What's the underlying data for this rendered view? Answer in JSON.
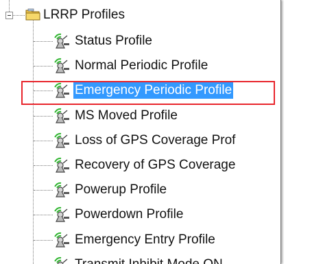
{
  "tree": {
    "root": {
      "label": "LRRP Profiles",
      "icon": "folder-icon",
      "expanded": true
    },
    "items": [
      {
        "label": "Status Profile",
        "icon": "gps-antenna-icon"
      },
      {
        "label": "Normal Periodic Profile",
        "icon": "gps-antenna-icon"
      },
      {
        "label": "Emergency Periodic Profile",
        "icon": "gps-antenna-icon",
        "selected": true
      },
      {
        "label": "MS Moved Profile",
        "icon": "gps-antenna-icon"
      },
      {
        "label": "Loss of GPS Coverage Prof",
        "icon": "gps-antenna-icon"
      },
      {
        "label": "Recovery of GPS Coverage",
        "icon": "gps-antenna-icon"
      },
      {
        "label": "Powerup Profile",
        "icon": "gps-antenna-icon"
      },
      {
        "label": "Powerdown Profile",
        "icon": "gps-antenna-icon"
      },
      {
        "label": "Emergency Entry Profile",
        "icon": "gps-antenna-icon"
      },
      {
        "label": "Transmit Inhibit Mode ON",
        "icon": "gps-antenna-icon"
      }
    ]
  },
  "colors": {
    "selection_bg": "#3399ff",
    "highlight_border": "#e8242b"
  }
}
